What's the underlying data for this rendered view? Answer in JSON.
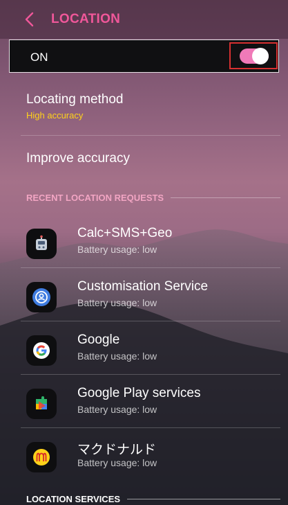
{
  "colors": {
    "accent_pink": "#f0579a",
    "toggle_on": "#f07ab8",
    "highlight_red": "#d63030",
    "subtitle_yellow": "#ffd21a",
    "recent_header": "#f2a5c3",
    "services_header": "#ffffff"
  },
  "header": {
    "back_icon": "chevron-left-icon",
    "title": "LOCATION"
  },
  "master_switch": {
    "label": "ON",
    "state": "on"
  },
  "settings": [
    {
      "title": "Locating method",
      "subtitle": "High accuracy"
    },
    {
      "title": "Improve accuracy"
    }
  ],
  "recent_requests": {
    "header": "RECENT LOCATION REQUESTS",
    "apps": [
      {
        "name": "Calc+SMS+Geo",
        "usage": "Battery usage: low",
        "icon": "robot-calculator-icon"
      },
      {
        "name": "Customisation Service",
        "usage": "Battery usage: low",
        "icon": "person-circle-icon"
      },
      {
        "name": "Google",
        "usage": "Battery usage: low",
        "icon": "google-g-icon"
      },
      {
        "name": "Google Play services",
        "usage": "Battery usage: low",
        "icon": "puzzle-piece-icon"
      },
      {
        "name": "マクドナルド",
        "usage": "Battery usage: low",
        "icon": "mcdonalds-arches-icon"
      }
    ]
  },
  "location_services": {
    "header": "LOCATION SERVICES"
  }
}
